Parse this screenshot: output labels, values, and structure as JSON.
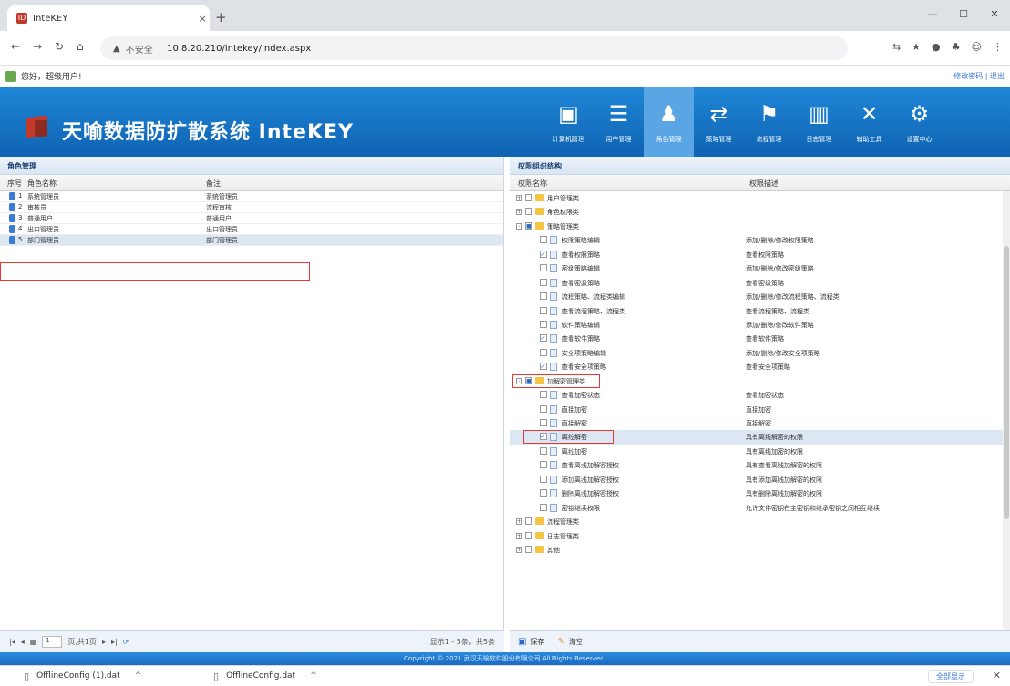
{
  "browser": {
    "tab_title": "InteKEY",
    "tab_close": "×",
    "new_tab": "+",
    "window_controls": [
      "—",
      "☐",
      "✕"
    ],
    "insecure_label": "不安全",
    "url": "10.8.20.210/intekey/Index.aspx"
  },
  "bookbar": {
    "greeting": "您好，超级用户!",
    "links": "修改密码 | 退出"
  },
  "app": {
    "title": "天喻数据防扩散系统 InteKEY",
    "menu": [
      {
        "label": "计算机管理",
        "icon": "monitor-icon"
      },
      {
        "label": "用户管理",
        "icon": "users-icon"
      },
      {
        "label": "角色管理",
        "icon": "role-icon",
        "active": true
      },
      {
        "label": "策略管理",
        "icon": "strategy-icon"
      },
      {
        "label": "流程管理",
        "icon": "flow-icon"
      },
      {
        "label": "日志管理",
        "icon": "log-icon"
      },
      {
        "label": "辅助工具",
        "icon": "tools-icon"
      },
      {
        "label": "设置中心",
        "icon": "settings-icon"
      }
    ]
  },
  "roles": {
    "panel_title": "角色管理",
    "headers": {
      "no": "序号",
      "name": "角色名称",
      "note": "备注"
    },
    "rows": [
      {
        "no": "1",
        "name": "系统管理员",
        "note": "系统管理员"
      },
      {
        "no": "2",
        "name": "审核员",
        "note": "流程审核"
      },
      {
        "no": "3",
        "name": "普通用户",
        "note": "普通用户"
      },
      {
        "no": "4",
        "name": "出口管理员",
        "note": "出口管理员"
      },
      {
        "no": "5",
        "name": "部门管理员",
        "note": "部门管理员"
      }
    ],
    "pager": {
      "page": "1",
      "total_pages": "页,共1页",
      "display": "显示1 - 5条，共5条"
    }
  },
  "perms": {
    "panel_title": "权限组织结构",
    "headers": {
      "name": "权限名称",
      "desc": "权限描述"
    },
    "rows": [
      {
        "name": "用户管理类",
        "desc": "",
        "folder": true,
        "exp": "+",
        "level": 0
      },
      {
        "name": "角色权限类",
        "desc": "",
        "folder": true,
        "exp": "+",
        "level": 0
      },
      {
        "name": "策略管理类",
        "desc": "",
        "folder": true,
        "exp": "-",
        "level": 0,
        "cb": "■"
      },
      {
        "name": "权限策略编辑",
        "desc": "添加/删除/修改权限策略",
        "level": 1
      },
      {
        "name": "查看权限策略",
        "desc": "查看权限策略",
        "level": 1,
        "cb": "✓"
      },
      {
        "name": "密级策略编辑",
        "desc": "添加/删除/修改密级策略",
        "level": 1
      },
      {
        "name": "查看密级策略",
        "desc": "查看密级策略",
        "level": 1
      },
      {
        "name": "流程策略、流程类编辑",
        "desc": "添加/删除/修改流程策略、流程类",
        "level": 1
      },
      {
        "name": "查看流程策略、流程类",
        "desc": "查看流程策略、流程类",
        "level": 1
      },
      {
        "name": "软件策略编辑",
        "desc": "添加/删除/修改软件策略",
        "level": 1
      },
      {
        "name": "查看软件策略",
        "desc": "查看软件策略",
        "level": 1,
        "cb": "✓"
      },
      {
        "name": "安全项策略编辑",
        "desc": "添加/删除/修改安全项策略",
        "level": 1
      },
      {
        "name": "查看安全项策略",
        "desc": "查看安全项策略",
        "level": 1,
        "cb": "✓"
      },
      {
        "name": "加解密管理类",
        "desc": "",
        "folder": true,
        "exp": "-",
        "level": 0,
        "cb": "■",
        "boxed": true
      },
      {
        "name": "查看加密状态",
        "desc": "查看加密状态",
        "level": 1
      },
      {
        "name": "直接加密",
        "desc": "直接加密",
        "level": 1
      },
      {
        "name": "直接解密",
        "desc": "直接解密",
        "level": 1
      },
      {
        "name": "离线解密",
        "desc": "具有离线解密的权限",
        "level": 1,
        "cb": "✓",
        "boxed": true,
        "hl": true
      },
      {
        "name": "离线加密",
        "desc": "具有离线加密的权限",
        "level": 1
      },
      {
        "name": "查看离线加解密授权",
        "desc": "具有查看离线加解密的权限",
        "level": 1
      },
      {
        "name": "添加离线加解密授权",
        "desc": "具有添加离线加解密的权限",
        "level": 1
      },
      {
        "name": "删除离线加解密授权",
        "desc": "具有删除离线加解密的权限",
        "level": 1
      },
      {
        "name": "密钥继续权限",
        "desc": "允许文件密钥在主密钥和继承密钥之间相互继续",
        "level": 1
      },
      {
        "name": "流程管理类",
        "desc": "",
        "folder": true,
        "exp": "+",
        "level": 0
      },
      {
        "name": "日志管理类",
        "desc": "",
        "folder": true,
        "exp": "+",
        "level": 0
      },
      {
        "name": "其他",
        "desc": "",
        "folder": true,
        "exp": "+",
        "level": 0
      }
    ],
    "save": "保存",
    "clear": "清空"
  },
  "footer": "Copyright © 2021 武汉天喻软件股份有限公司 All Rights Reserved.",
  "downloads": {
    "items": [
      "OfflineConfig (1).dat",
      "OfflineConfig.dat"
    ],
    "show_all": "全部显示",
    "close": "✕"
  }
}
